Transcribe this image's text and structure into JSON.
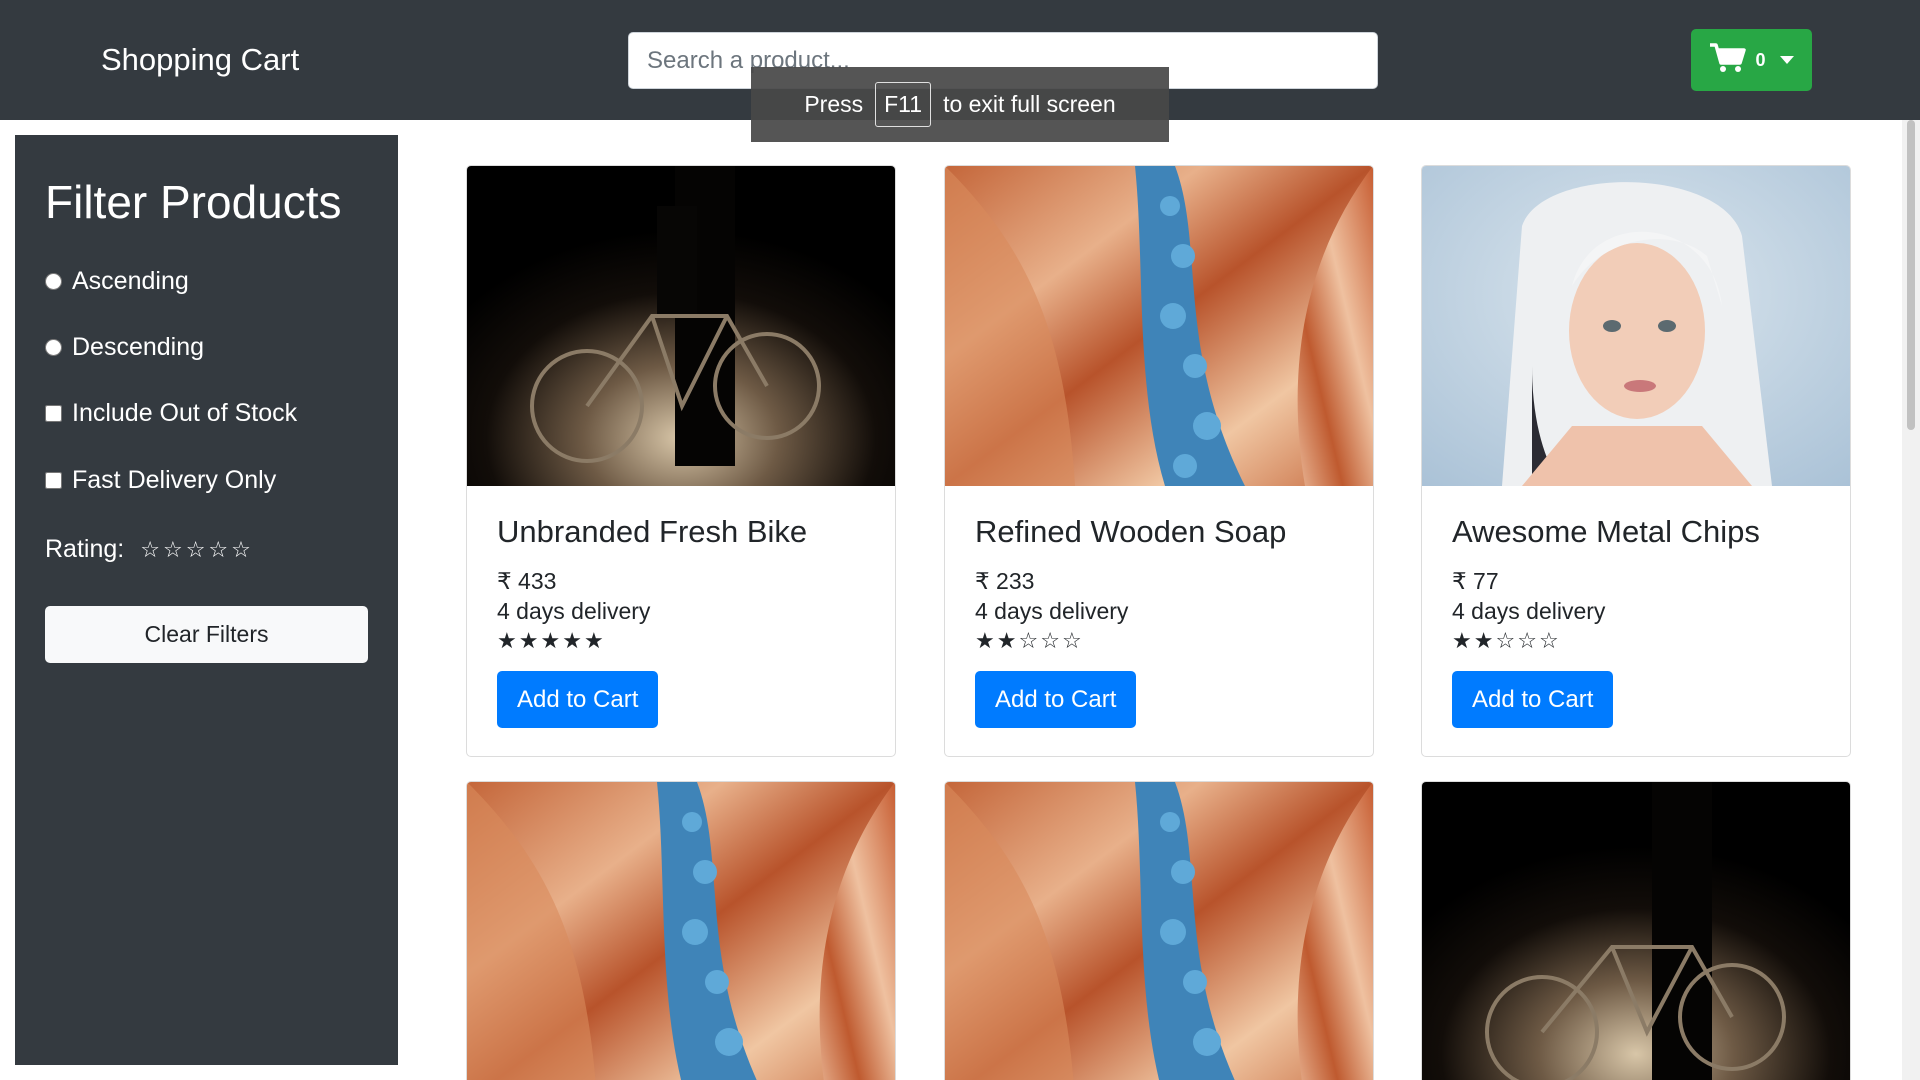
{
  "navbar": {
    "brand": "Shopping Cart",
    "search_placeholder": "Search a product...",
    "cart_count": "0",
    "accent": "#28a745"
  },
  "fullscreen_toast": {
    "press": "Press",
    "key": "F11",
    "message": "to exit full screen"
  },
  "sidebar": {
    "title": "Filter Products",
    "options": {
      "ascending": "Ascending",
      "descending": "Descending",
      "out_of_stock": "Include Out of Stock",
      "fast_delivery": "Fast Delivery Only"
    },
    "rating_label": "Rating:",
    "rating_value": 0,
    "clear_label": "Clear Filters"
  },
  "products": [
    {
      "name": "Unbranded Fresh Bike",
      "price": "₹ 433",
      "delivery": "4 days delivery",
      "rating": 5,
      "image": "bike-photo",
      "button": "Add to Cart"
    },
    {
      "name": "Refined Wooden Soap",
      "price": "₹ 233",
      "delivery": "4 days delivery",
      "rating": 2,
      "image": "canyon-photo",
      "button": "Add to Cart"
    },
    {
      "name": "Awesome Metal Chips",
      "price": "₹ 77",
      "delivery": "4 days delivery",
      "rating": 2,
      "image": "portrait-photo",
      "button": "Add to Cart"
    },
    {
      "image": "canyon-photo"
    },
    {
      "image": "canyon-photo"
    },
    {
      "image": "bike-photo"
    }
  ]
}
